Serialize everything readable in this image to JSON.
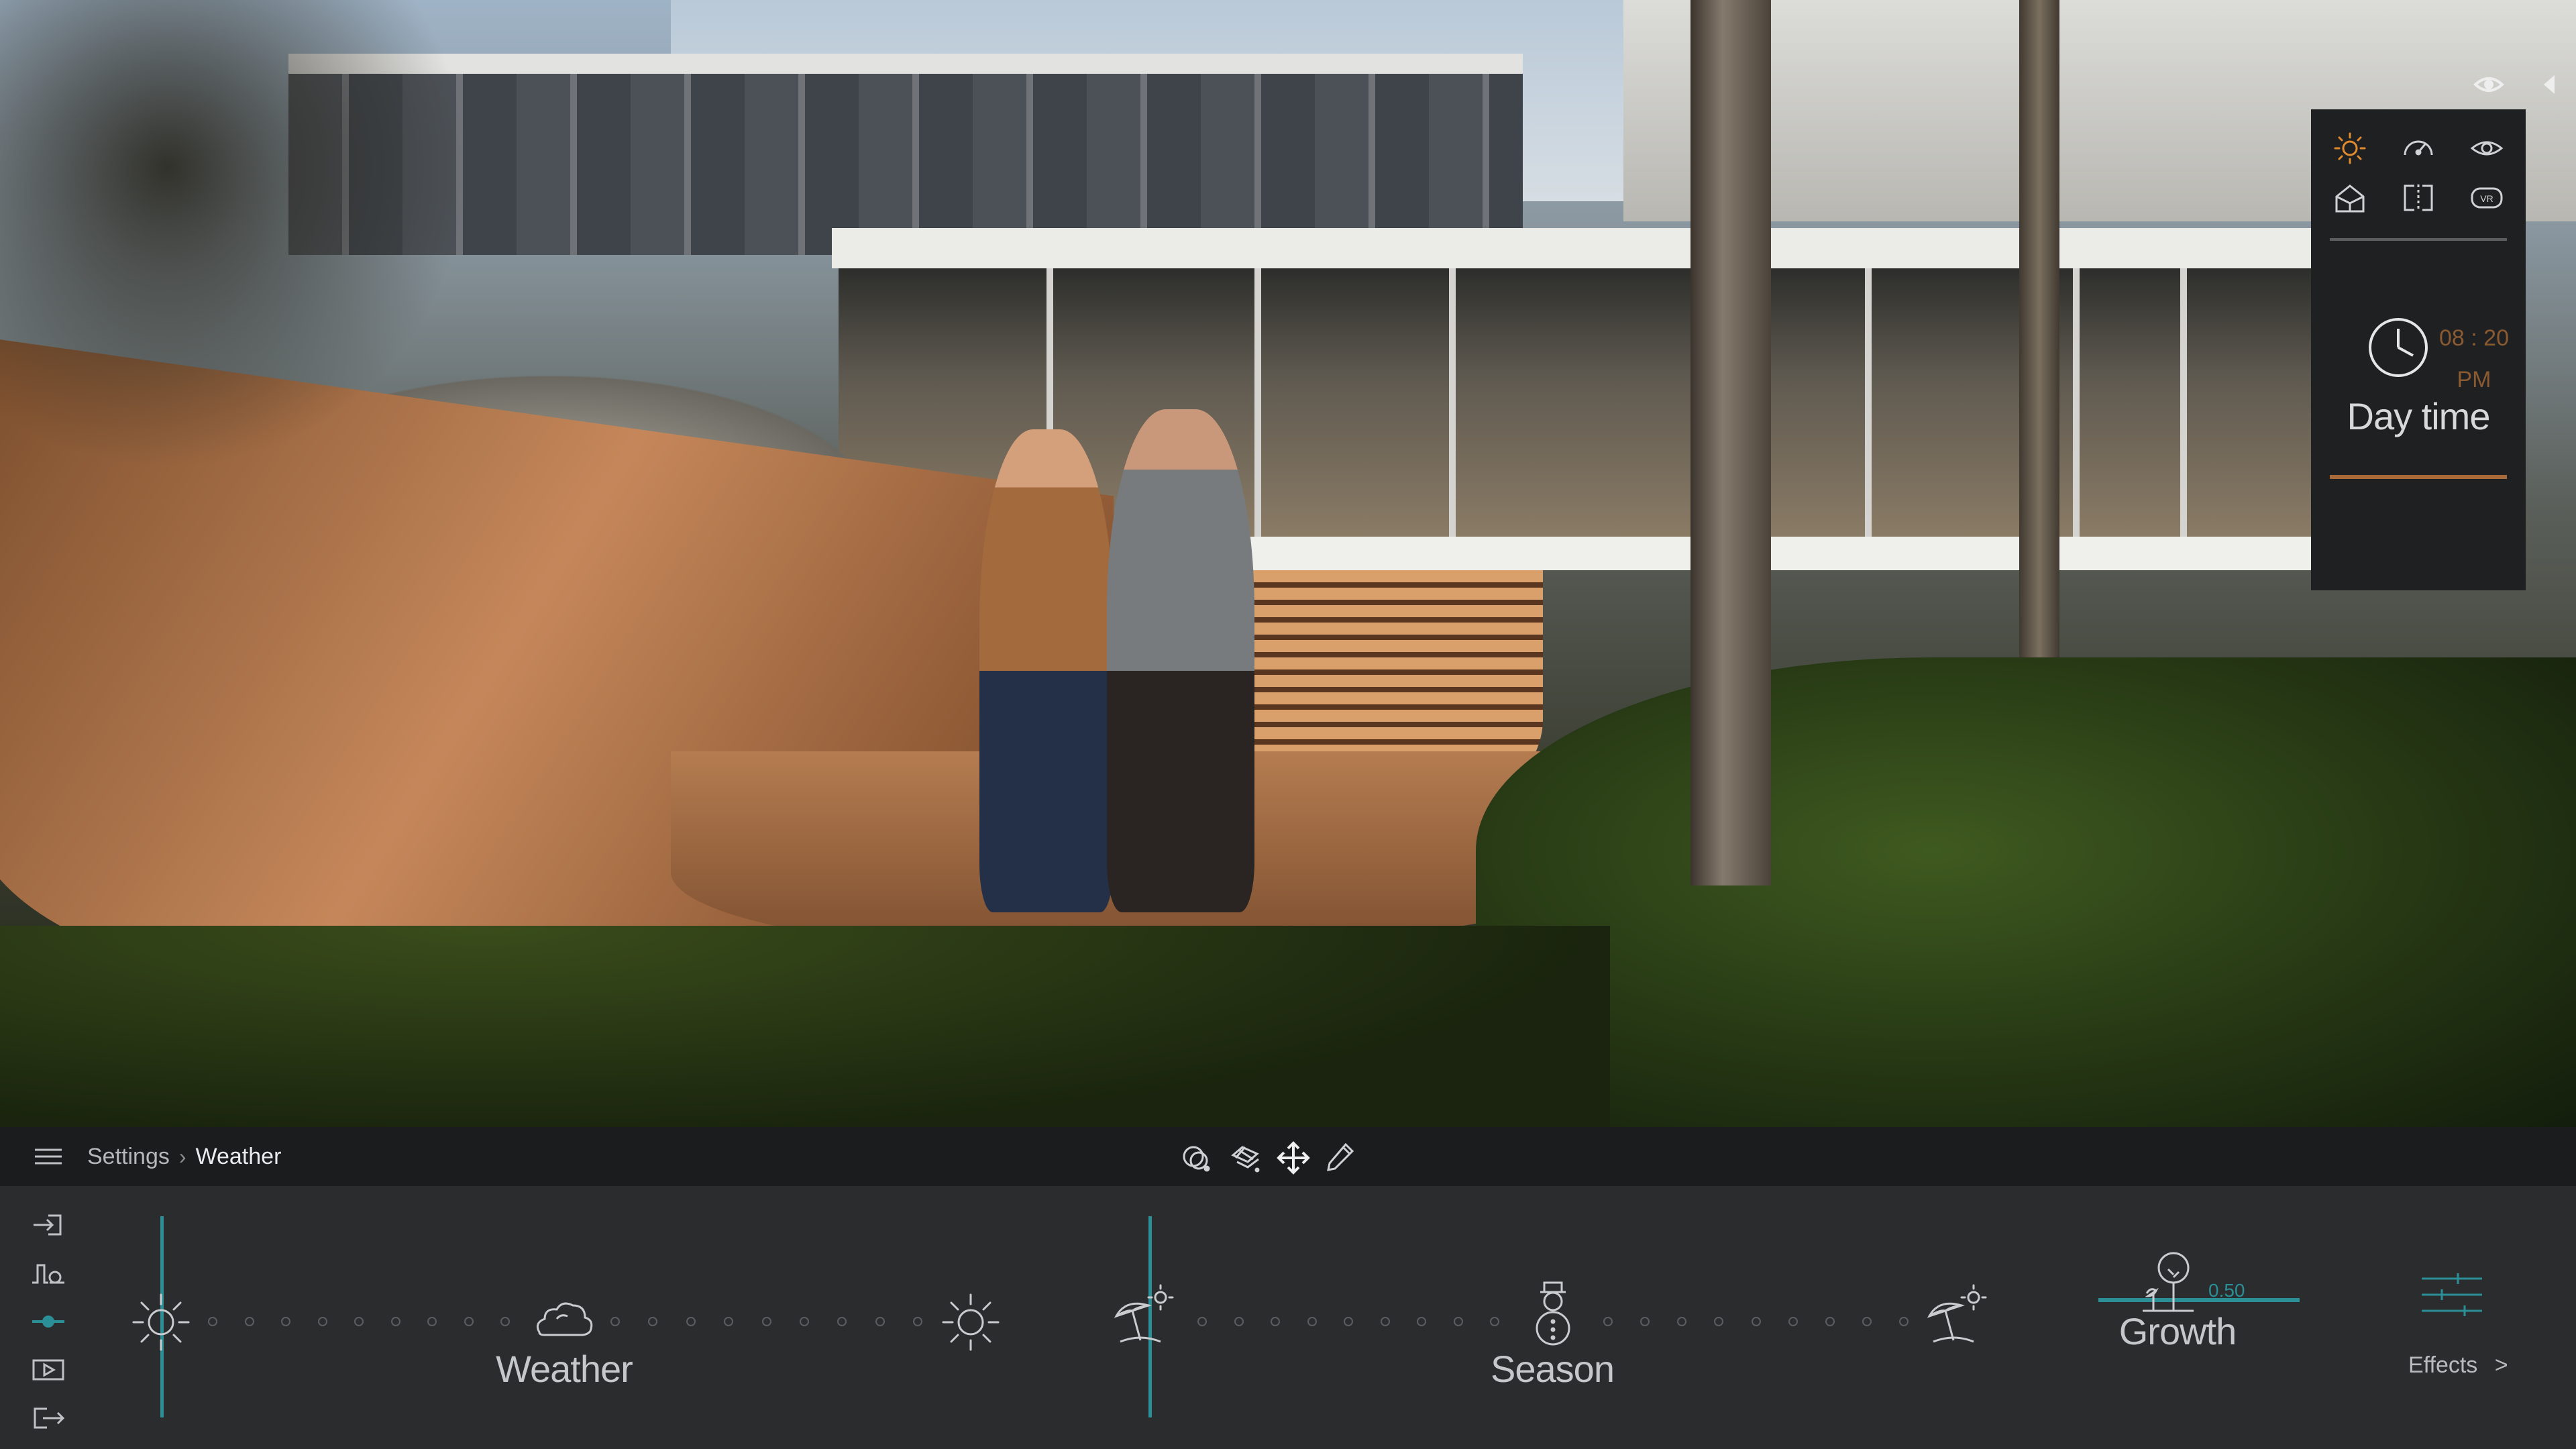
{
  "viewport": {
    "scene": "3D architectural render of a modern house with a curved wooden walkway, a couple, trees and vegetation"
  },
  "top_right": {
    "eye_icon": "eye-icon",
    "collapse_icon": "triangle-left-icon"
  },
  "quick_panel": {
    "icons": [
      "sun-icon",
      "speedometer-icon",
      "eye-icon",
      "house-icon",
      "frame-icon",
      "vr-icon"
    ],
    "time": "08 : 20 PM",
    "time_hm": "08 : 20",
    "time_ampm": "PM",
    "label": "Day time",
    "accent_color": "#a86a38"
  },
  "toolbar": {
    "menu_icon": "hamburger-icon",
    "breadcrumb": [
      "Settings",
      "Weather"
    ],
    "tools": [
      "orbit-icon",
      "layers-icon",
      "move-icon",
      "pen-icon"
    ]
  },
  "settings": {
    "side_icons": [
      "login-icon",
      "animation-icon",
      "slider-icon",
      "media-icon",
      "logout-icon"
    ],
    "weather": {
      "label": "Weather",
      "left_icon": "sun-icon",
      "center_icon": "cloud-icon",
      "right_icon": "sun-icon"
    },
    "season": {
      "label": "Season",
      "left_icon": "beach-umbrella-icon",
      "center_icon": "snowman-icon",
      "right_icon": "beach-umbrella-icon"
    },
    "growth": {
      "label": "Growth",
      "value": "0.50",
      "icon": "tree-icon"
    },
    "effects": {
      "label": "Effects",
      "icon": "sliders-icon",
      "arrow": ">"
    },
    "accent_color": "#2a8f96"
  }
}
